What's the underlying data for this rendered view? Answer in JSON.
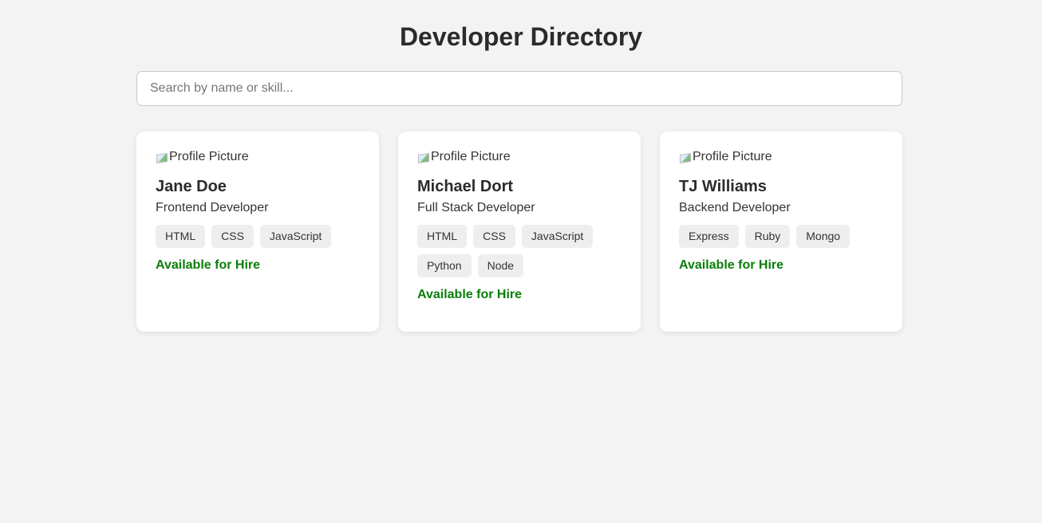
{
  "page": {
    "title": "Developer Directory"
  },
  "search": {
    "placeholder": "Search by name or skill...",
    "value": ""
  },
  "colors": {
    "background": "#f3f3f3",
    "card": "#ffffff",
    "tag": "#eeeeee",
    "available": "#0a7d0a"
  },
  "developers": [
    {
      "avatar_alt": "Profile Picture",
      "name": "Jane Doe",
      "role": "Frontend Developer",
      "skills": [
        "HTML",
        "CSS",
        "JavaScript"
      ],
      "status": "Available for Hire"
    },
    {
      "avatar_alt": "Profile Picture",
      "name": "Michael Dort",
      "role": "Full Stack Developer",
      "skills": [
        "HTML",
        "CSS",
        "JavaScript",
        "Python",
        "Node"
      ],
      "status": "Available for Hire"
    },
    {
      "avatar_alt": "Profile Picture",
      "name": "TJ Williams",
      "role": "Backend Developer",
      "skills": [
        "Express",
        "Ruby",
        "Mongo"
      ],
      "status": "Available for Hire"
    }
  ]
}
